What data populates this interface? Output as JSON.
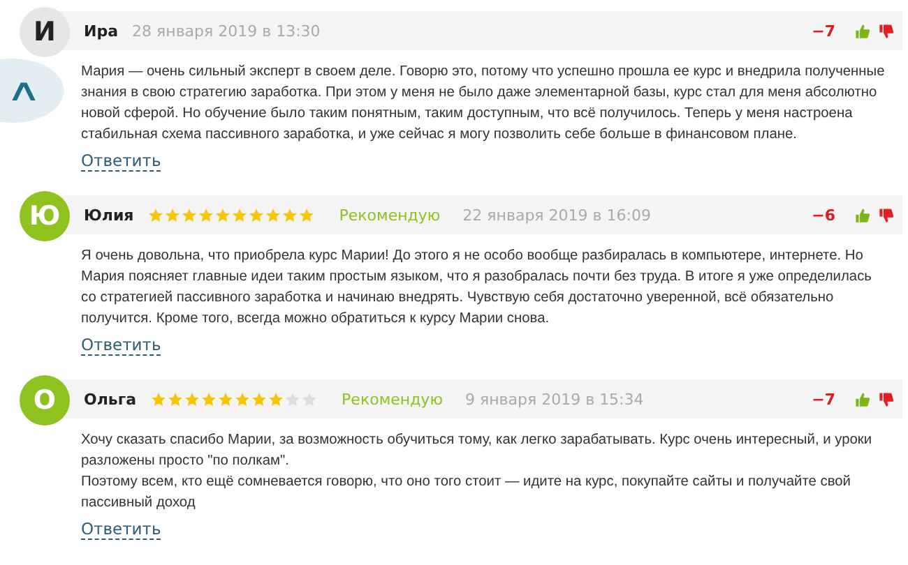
{
  "scroll_up_button": {
    "label": "∧"
  },
  "comments": [
    {
      "initial": "И",
      "color": "#e6e6e6",
      "author": "Ира",
      "date": "28 января 2019 в 13:30",
      "score": "−7",
      "text": "Мария — очень сильный эксперт в своем деле. Говорю это, потому что успешно прошла ее курс и внедрила полученные знания в свою стратегию заработка. При этом у меня не было даже элементарной базы, курс стал для меня абсолютно новой сферой. Но обучение было таким понятным, таким доступным, что всё получилось. Теперь у меня настроена стабильная схема пассивного заработка, и уже сейчас я могу позволить себе больше в финансовом плане.",
      "reply": "Ответить"
    },
    {
      "initial": "Ю",
      "color": "#8dc21f",
      "author": "Юлия",
      "stars": 10,
      "recommend": "Рекомендую",
      "date": "22 января 2019 в 16:09",
      "score": "−6",
      "text": "Я очень довольна, что приобрела курс Марии! До этого я не особо вообще разбиралась в компьютере, интернете. Но Мария поясняет главные идеи таким простым языком, что я разобралась почти без труда. В итоге я уже определилась со стратегией пассивного заработка и начинаю внедрять. Чувствую себя достаточно уверенной, всё обязательно получится. Кроме того, всегда можно обратиться к курсу Марии снова.",
      "reply": "Ответить"
    },
    {
      "initial": "О",
      "color": "#8dc21f",
      "author": "Ольга",
      "stars": 8,
      "recommend": "Рекомендую",
      "date": "9 января 2019 в 15:34",
      "score": "−7",
      "text": "Хочу сказать спасибо Марии, за возможность обучиться тому, как легко зарабатывать. Курс очень интересный, и уроки разложены просто \"по полкам\".\nПоэтому всем, кто ещё сомневается говорю, что оно того стоит — идите на курс, покупайте сайты и получайте свой пассивный доход",
      "reply": "Ответить"
    }
  ]
}
